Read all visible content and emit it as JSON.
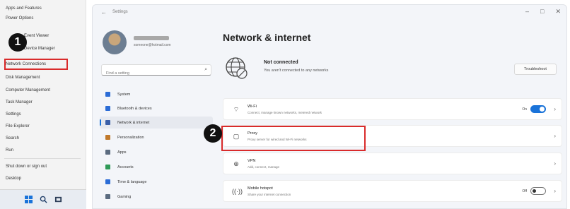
{
  "winx_menu": {
    "items": [
      "Apps and Features",
      "Power Options",
      "Event Viewer",
      "Device Manager",
      "Network Connections",
      "Disk Management",
      "Computer Management",
      "Task Manager",
      "Settings",
      "File Explorer",
      "Search",
      "Run",
      "Shut down or sign out",
      "Desktop"
    ]
  },
  "markers": {
    "one": "1",
    "two": "2"
  },
  "window": {
    "title": "Settings",
    "back": "←",
    "minimize": "–",
    "maximize": "□",
    "close": "✕"
  },
  "user": {
    "email": "someone@hotmail.com"
  },
  "search": {
    "placeholder": "Find a setting"
  },
  "nav": {
    "items": [
      {
        "label": "System",
        "color": "#2b6cd6"
      },
      {
        "label": "Bluetooth & devices",
        "color": "#2b6cd6"
      },
      {
        "label": "Network & internet",
        "color": "#3a5fa8"
      },
      {
        "label": "Personalization",
        "color": "#c0792b"
      },
      {
        "label": "Apps",
        "color": "#5b6b80"
      },
      {
        "label": "Accounts",
        "color": "#2f9a58"
      },
      {
        "label": "Time & language",
        "color": "#2b6cd6"
      },
      {
        "label": "Gaming",
        "color": "#5b6b80"
      }
    ]
  },
  "main": {
    "title": "Network & internet",
    "status_title": "Not connected",
    "status_sub": "You aren't connected to any networks",
    "troubleshoot": "Troubleshoot",
    "cards": [
      {
        "title": "Wi-Fi",
        "sub": "Connect, manage known networks, metered network",
        "toggle": "On",
        "icon": "wifi-icon"
      },
      {
        "title": "Proxy",
        "sub": "Proxy server for wired and Wi-Fi networks",
        "icon": "proxy-icon"
      },
      {
        "title": "VPN",
        "sub": "Add, connect, manage",
        "icon": "vpn-icon"
      },
      {
        "title": "Mobile hotspot",
        "sub": "Share your internet connection",
        "toggle": "Off",
        "icon": "hotspot-icon"
      }
    ]
  },
  "colors": {
    "accent": "#1a73d9",
    "highlight": "#d92b2b"
  }
}
